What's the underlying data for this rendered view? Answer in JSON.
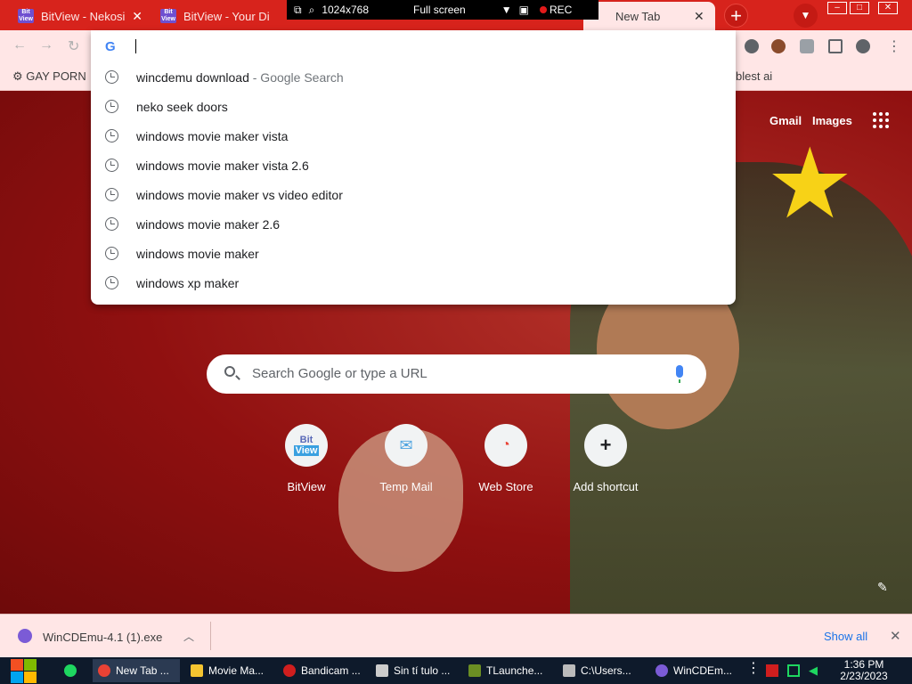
{
  "tabs": [
    {
      "title": "BitView - Nekosi",
      "active": false
    },
    {
      "title": "BitView - Your Di",
      "active": false
    },
    {
      "title": "New Tab",
      "active": true
    }
  ],
  "recorder": {
    "resolution": "1024x768",
    "mode": "Full screen",
    "rec_label": "REC"
  },
  "bookmarks": [
    {
      "label": "GAY PORN"
    },
    {
      "label": "blest ai"
    }
  ],
  "omnibox": {
    "input_value": "",
    "suggestions": [
      {
        "text": "wincdemu download",
        "extra": " - Google Search"
      },
      {
        "text": "neko seek doors",
        "extra": ""
      },
      {
        "text": "windows movie maker vista",
        "extra": ""
      },
      {
        "text": "windows movie maker vista 2.6",
        "extra": ""
      },
      {
        "text": "windows movie maker vs video editor",
        "extra": ""
      },
      {
        "text": "windows movie maker 2.6",
        "extra": ""
      },
      {
        "text": "windows movie maker",
        "extra": ""
      },
      {
        "text": "windows xp maker",
        "extra": ""
      }
    ]
  },
  "ntp": {
    "gmail": "Gmail",
    "images": "Images",
    "search_placeholder": "Search Google or type a URL",
    "shortcuts": [
      {
        "label": "BitView",
        "icon": "Bit View"
      },
      {
        "label": "Temp Mail",
        "icon": "mail-icon"
      },
      {
        "label": "Web Store",
        "icon": "chrome-webstore-icon"
      },
      {
        "label": "Add shortcut",
        "icon": "+"
      }
    ]
  },
  "downloads": {
    "file": "WinCDEmu-4.1 (1).exe",
    "show_all": "Show all"
  },
  "taskbar": {
    "items": [
      {
        "label": "New Tab ...",
        "color": "#e94235"
      },
      {
        "label": "Movie Ma...",
        "color": "#f4c430"
      },
      {
        "label": "Bandicam ...",
        "color": "#d01e1e"
      },
      {
        "label": "Sin tí tulo ...",
        "color": "#cccccc"
      },
      {
        "label": "TLaunche...",
        "color": "#6b8e23"
      },
      {
        "label": "C:\\Users...",
        "color": "#bbbbbb"
      },
      {
        "label": "WinCDEm...",
        "color": "#7b5bd6"
      }
    ],
    "time": "1:36 PM",
    "date": "2/23/2023"
  },
  "colors": {
    "tabstrip": "#d7231c",
    "toolbar": "#ffe6e6",
    "taskbar": "#0e1a2b"
  }
}
